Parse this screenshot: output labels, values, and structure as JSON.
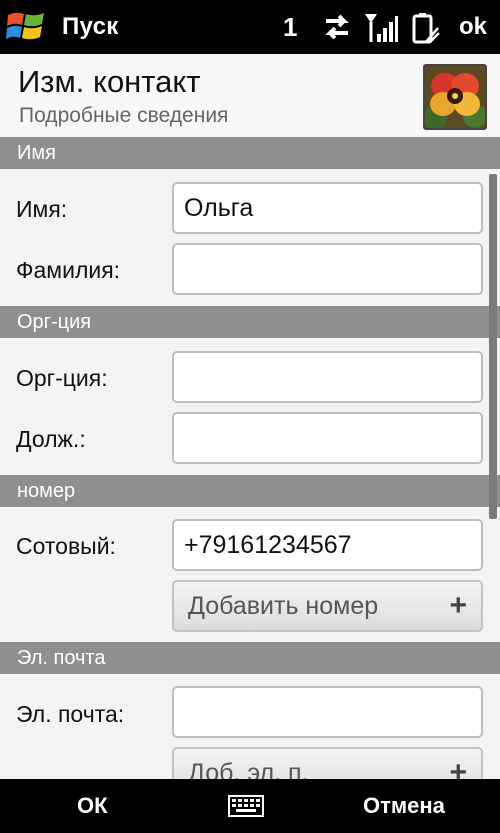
{
  "statusbar": {
    "start_label": "Пуск",
    "notification_count": "1",
    "ok_label": "ok",
    "icons": [
      "windows-logo-icon",
      "data-transfer-icon",
      "signal-strength-icon",
      "battery-icon"
    ]
  },
  "header": {
    "title": "Изм. контакт",
    "subtitle": "Подробные сведения",
    "photo_icon": "contact-photo-flower"
  },
  "sections": {
    "name": {
      "header": "Имя",
      "first_name_label": "Имя:",
      "first_name_value": "Ольга",
      "last_name_label": "Фамилия:",
      "last_name_value": ""
    },
    "org": {
      "header": "Орг-ция",
      "company_label": "Орг-ция:",
      "company_value": "",
      "title_label": "Долж.:",
      "title_value": ""
    },
    "phone": {
      "header": "номер",
      "mobile_label": "Сотовый:",
      "mobile_value": "+79161234567",
      "add_label": "Добавить номер"
    },
    "email": {
      "header": "Эл. почта",
      "email_label": "Эл. почта:",
      "email_value": "",
      "add_label": "Доб. эл. п."
    }
  },
  "softkeys": {
    "left": "ОК",
    "right": "Отмена",
    "center_icon": "keyboard-icon"
  },
  "colors": {
    "section_header_bg": "#8f8f8f",
    "bar_bg": "#000000",
    "content_bg": "#f3f3f3"
  }
}
